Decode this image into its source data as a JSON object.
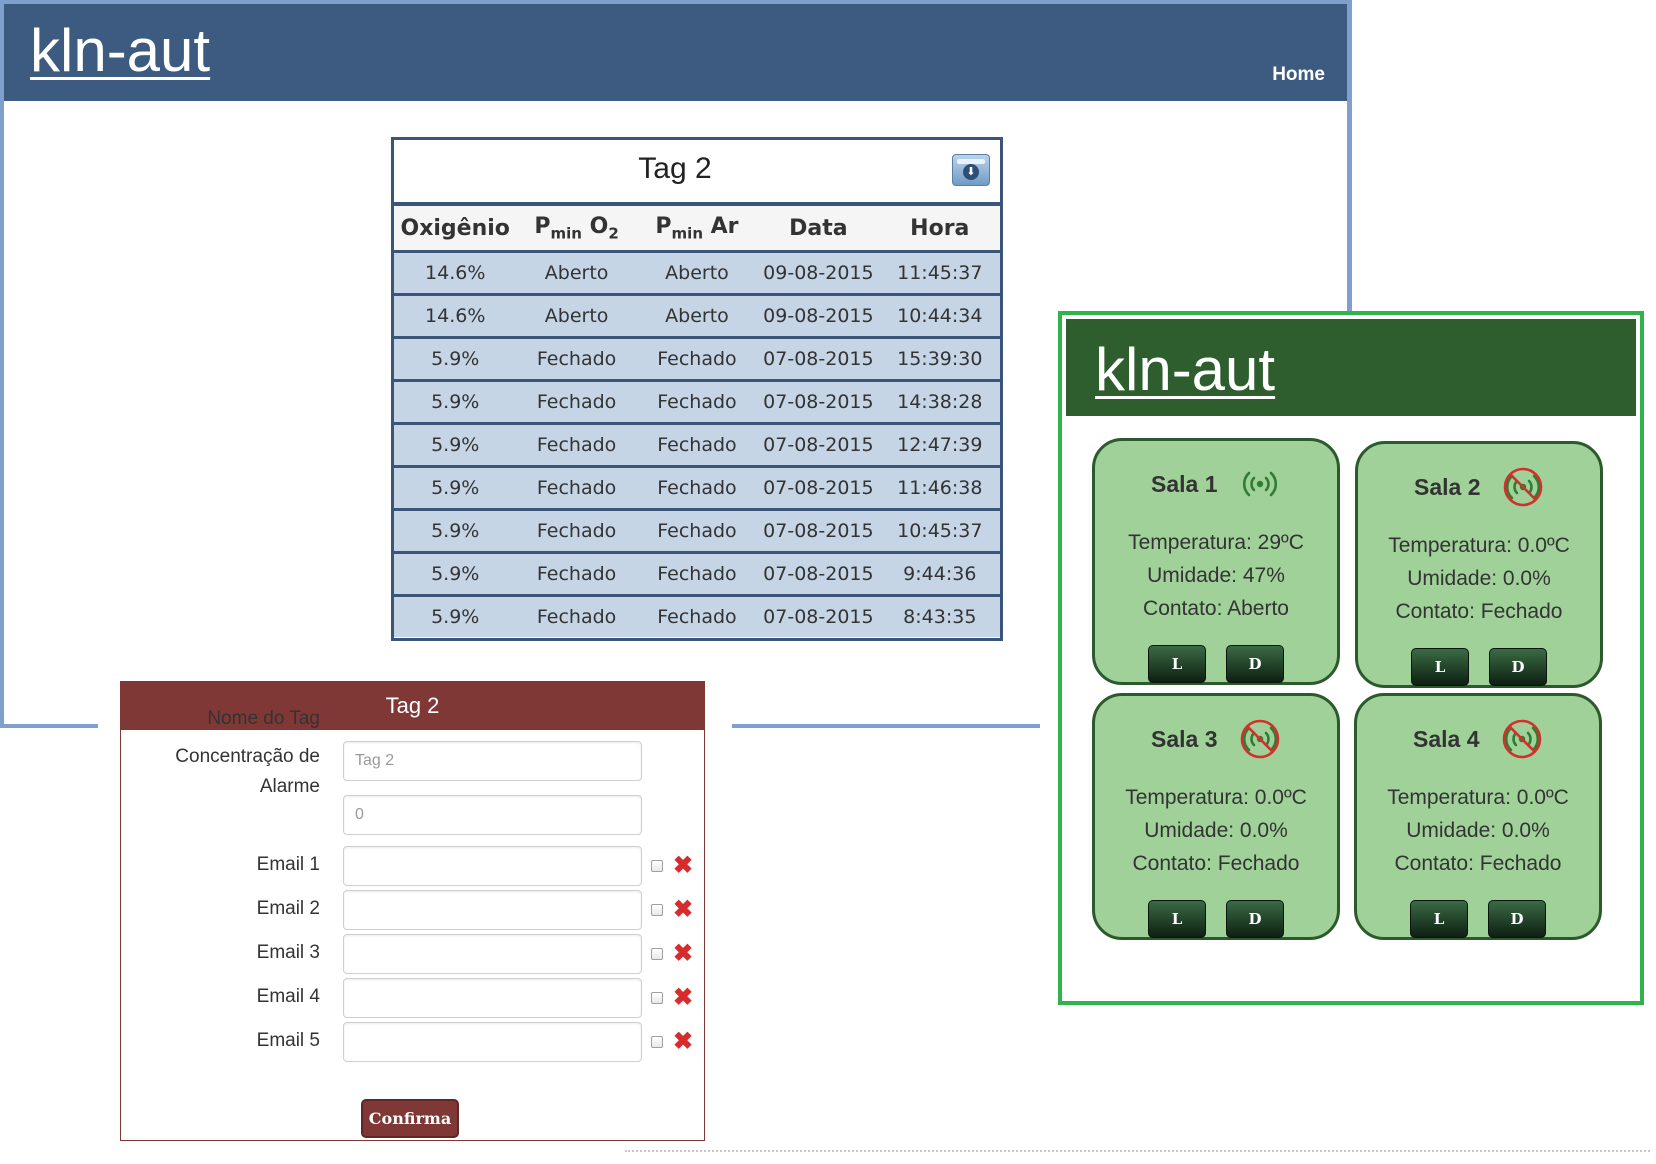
{
  "blue_window": {
    "logo": "kln-aut",
    "nav_home": "Home",
    "header_color": "#3d5b80",
    "border_color": "#7f9fcc"
  },
  "tag_table": {
    "title": "Tag 2",
    "export_icon": "export-download-icon",
    "headers": [
      {
        "main": "Oxigênio",
        "sub": "",
        "tail": ""
      },
      {
        "main": "P",
        "sub": "min",
        "tail": " O",
        "tail_sub": "2"
      },
      {
        "main": "P",
        "sub": "min",
        "tail": " Ar",
        "tail_sub": ""
      },
      {
        "main": "Data",
        "sub": "",
        "tail": ""
      },
      {
        "main": "Hora",
        "sub": "",
        "tail": ""
      }
    ],
    "rows": [
      [
        "14.6%",
        "Aberto",
        "Aberto",
        "09-08-2015",
        "11:45:37"
      ],
      [
        "14.6%",
        "Aberto",
        "Aberto",
        "09-08-2015",
        "10:44:34"
      ],
      [
        "5.9%",
        "Fechado",
        "Fechado",
        "07-08-2015",
        "15:39:30"
      ],
      [
        "5.9%",
        "Fechado",
        "Fechado",
        "07-08-2015",
        "14:38:28"
      ],
      [
        "5.9%",
        "Fechado",
        "Fechado",
        "07-08-2015",
        "12:47:39"
      ],
      [
        "5.9%",
        "Fechado",
        "Fechado",
        "07-08-2015",
        "11:46:38"
      ],
      [
        "5.9%",
        "Fechado",
        "Fechado",
        "07-08-2015",
        "10:45:37"
      ],
      [
        "5.9%",
        "Fechado",
        "Fechado",
        "07-08-2015",
        "9:44:36"
      ],
      [
        "5.9%",
        "Fechado",
        "Fechado",
        "07-08-2015",
        "8:43:35"
      ]
    ]
  },
  "tag_form": {
    "title": "Tag 2",
    "header_color": "#7f3835",
    "fields": [
      {
        "label": "Nome do Tag",
        "value": "Tag 2"
      },
      {
        "label": "Concentração de Alarme",
        "value": "0"
      }
    ],
    "emails": [
      {
        "label": "Email 1",
        "value": ""
      },
      {
        "label": "Email 2",
        "value": ""
      },
      {
        "label": "Email 3",
        "value": ""
      },
      {
        "label": "Email 4",
        "value": ""
      },
      {
        "label": "Email 5",
        "value": ""
      }
    ],
    "delete_icon": "red-x-delete-icon",
    "confirm_label": "Confirma"
  },
  "green_window": {
    "logo": "kln-aut",
    "header_color": "#2e5e2e",
    "border_color": "#2fb34a",
    "rooms": [
      {
        "name": "Sala 1",
        "signal": "online",
        "temperature": "Temperatura: 29ºC",
        "humidity": "Umidade: 47%",
        "contact": "Contato: Aberto",
        "btn_l": "L",
        "btn_d": "D"
      },
      {
        "name": "Sala 2",
        "signal": "offline",
        "temperature": "Temperatura: 0.0ºC",
        "humidity": "Umidade: 0.0%",
        "contact": "Contato: Fechado",
        "btn_l": "L",
        "btn_d": "D"
      },
      {
        "name": "Sala 3",
        "signal": "offline",
        "temperature": "Temperatura: 0.0ºC",
        "humidity": "Umidade: 0.0%",
        "contact": "Contato: Fechado",
        "btn_l": "L",
        "btn_d": "D"
      },
      {
        "name": "Sala 4",
        "signal": "offline",
        "temperature": "Temperatura: 0.0ºC",
        "humidity": "Umidade: 0.0%",
        "contact": "Contato: Fechado",
        "btn_l": "L",
        "btn_d": "D"
      }
    ]
  }
}
